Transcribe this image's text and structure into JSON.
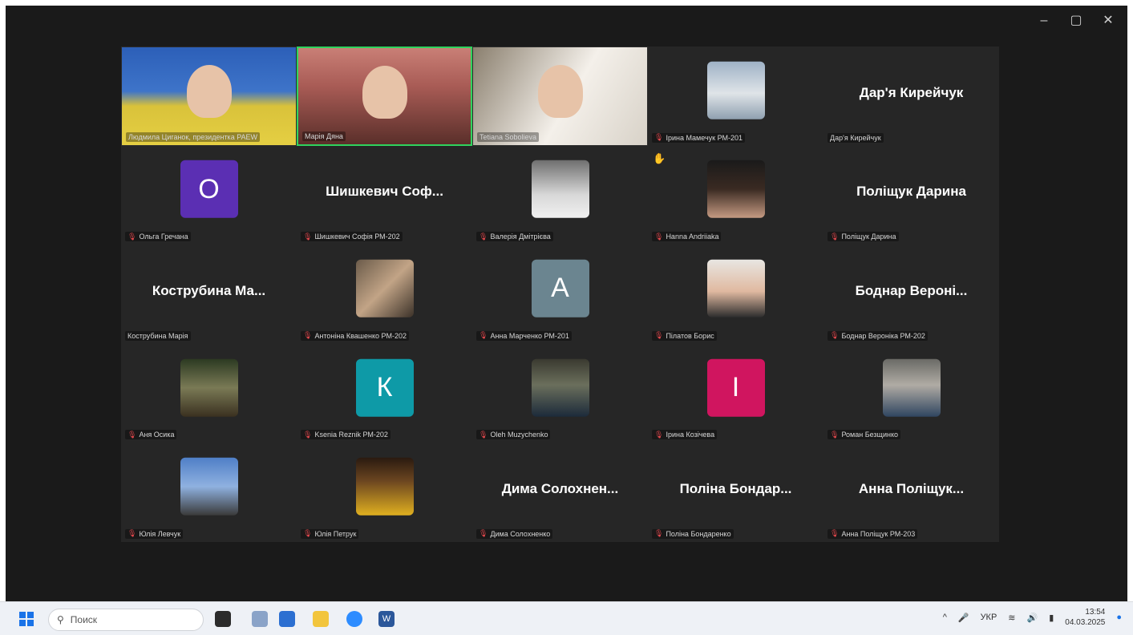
{
  "window": {
    "controls": [
      "–",
      "▢",
      "✕"
    ]
  },
  "tiles": [
    {
      "kind": "video",
      "scene": "banner",
      "name": "Людмила Циганок, президентка PAEW",
      "muted": false
    },
    {
      "kind": "video",
      "scene": "bookshelf",
      "name": "Марія Дяна",
      "muted": false,
      "speaking": true
    },
    {
      "kind": "video",
      "scene": "bright",
      "name": "Tetiana Sobolieva",
      "muted": false
    },
    {
      "kind": "photo",
      "photo": "woman-standing",
      "name": "Ірина Мамечук РМ-201",
      "muted": true
    },
    {
      "kind": "text",
      "big": "Дар'я Кирейчук",
      "name": "Дар'я Кирейчук",
      "muted": false
    },
    {
      "kind": "initial",
      "initial": "О",
      "color": "#5b2fb3",
      "name": "Ольга Гречана",
      "muted": true
    },
    {
      "kind": "text",
      "big": "Шишкевич  Соф...",
      "name": "Шишкевич Софія РМ-202",
      "muted": true
    },
    {
      "kind": "photo",
      "photo": "baby",
      "name": "Валерія Дмітрієва",
      "muted": true
    },
    {
      "kind": "photo",
      "photo": "dark-hair",
      "name": "Hanna Andriiaka",
      "muted": true,
      "hand": true
    },
    {
      "kind": "text",
      "big": "Поліщук Дарина",
      "name": "Поліщук Дарина",
      "muted": true
    },
    {
      "kind": "text",
      "big": "Кострубина  Ма...",
      "name": "Кострубина Марія",
      "muted": false
    },
    {
      "kind": "photo",
      "photo": "glasses",
      "name": "Антоніна Квашенко РМ-202",
      "muted": true
    },
    {
      "kind": "initial",
      "initial": "А",
      "color": "#6b8590",
      "name": "Анна Марченко РМ-201",
      "muted": true
    },
    {
      "kind": "photo",
      "photo": "young-man",
      "name": "Пілатов Борис",
      "muted": true
    },
    {
      "kind": "text",
      "big": "Боднар  Вероні...",
      "name": "Боднар Вероніка РМ-202",
      "muted": true
    },
    {
      "kind": "photo",
      "photo": "outdoor-girl",
      "name": "Аня Осика",
      "muted": true
    },
    {
      "kind": "initial",
      "initial": "К",
      "color": "#0e9aa7",
      "name": "Ksenia Reznik РМ-202",
      "muted": true
    },
    {
      "kind": "photo",
      "photo": "man-night",
      "name": "Oleh Muzychenko",
      "muted": true
    },
    {
      "kind": "initial",
      "initial": "І",
      "color": "#d0155f",
      "name": "Ірина Козічева",
      "muted": true
    },
    {
      "kind": "photo",
      "photo": "man-jacket",
      "name": "Роман Безщинко",
      "muted": true
    },
    {
      "kind": "photo",
      "photo": "tower",
      "name": "Юлія Левчук",
      "muted": true
    },
    {
      "kind": "photo",
      "photo": "yellow",
      "name": "Юлія Петрук",
      "muted": true
    },
    {
      "kind": "text",
      "big": "Дима  Солохнен...",
      "name": "Дима Солохненко",
      "muted": true
    },
    {
      "kind": "text",
      "big": "Поліна  Бондар...",
      "name": "Поліна Бондаренко",
      "muted": true
    },
    {
      "kind": "text",
      "big": "Анна  Поліщук...",
      "name": "Анна Поліщук РМ-203",
      "muted": true
    }
  ],
  "taskbar": {
    "search_placeholder": "Поиск",
    "tray": {
      "language": "УКР",
      "time": "13:54",
      "date": "04.03.2025"
    }
  }
}
